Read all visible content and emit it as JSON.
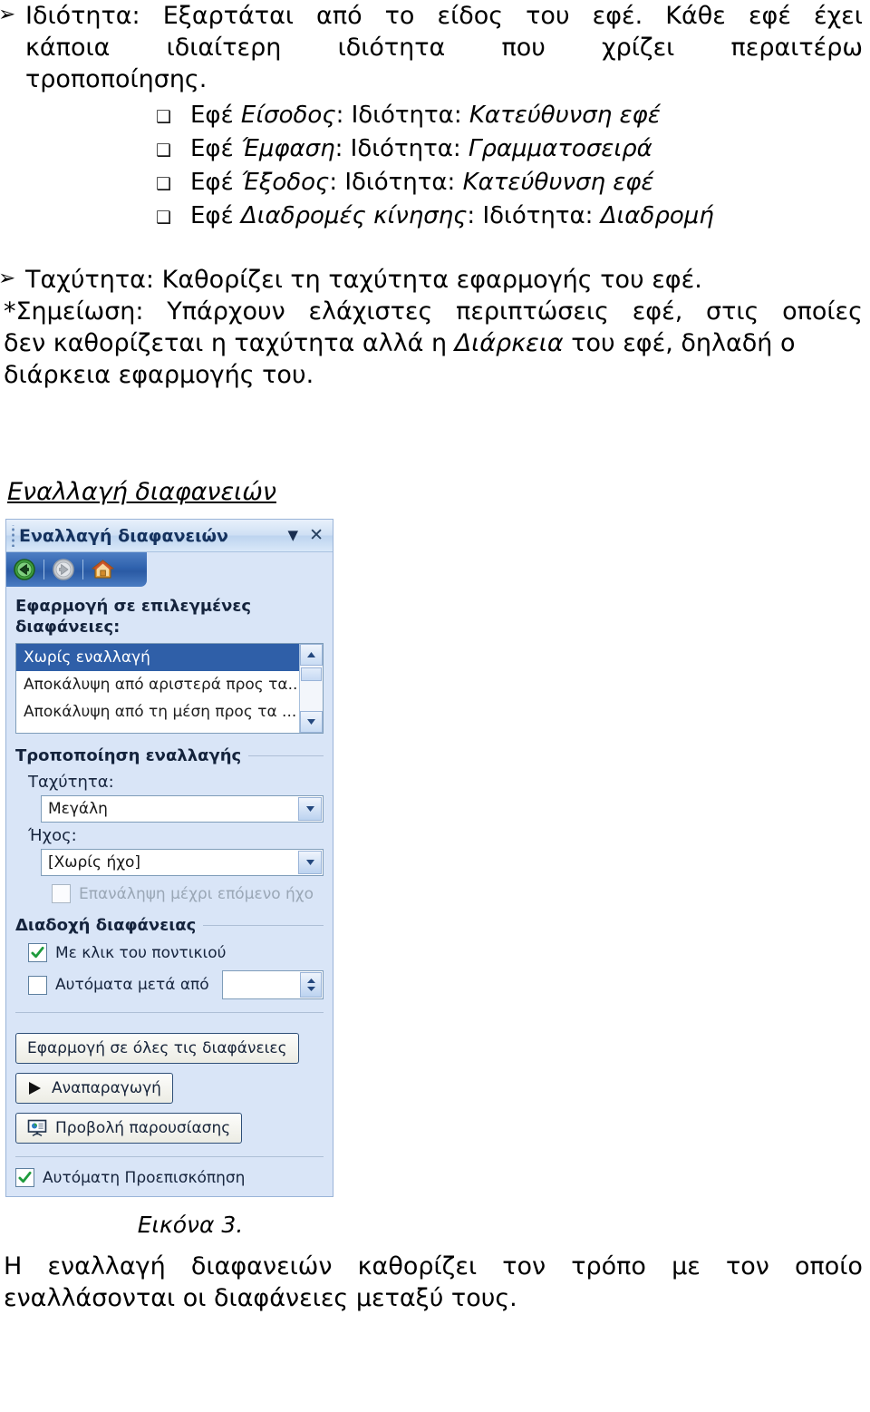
{
  "document": {
    "bullet_arrow": "➢",
    "bullet_square": "❑",
    "property_para": {
      "line1_left": "Ιδιότητα:",
      "line1_w1": "Εξαρτάται",
      "line1_w2": "από",
      "line1_w3": "το",
      "line1_w4": "είδος",
      "line1_w5": "του",
      "line1_w6": "εφέ.",
      "line1_w7": "Κάθε",
      "line1_w8": "εφέ",
      "line1_w9": "έχει",
      "line2_w1": "κάποια",
      "line2_w2": "ιδιαίτερη",
      "line2_w3": "ιδιότητα",
      "line2_w4": "που",
      "line2_w5": "χρίζει",
      "line2_w6": "περαιτέρω",
      "line3": "τροποποίησης."
    },
    "effect_list": [
      {
        "prefix": "Εφέ ",
        "name": "Είσοδος",
        "mid": ": Ιδιότητα: ",
        "value": "Κατεύθυνση εφέ"
      },
      {
        "prefix": "Εφέ ",
        "name": "Έμφαση",
        "mid": ": Ιδιότητα: ",
        "value": "Γραμματοσειρά"
      },
      {
        "prefix": "Εφέ ",
        "name": "Έξοδος",
        "mid": ": Ιδιότητα: ",
        "value": "Κατεύθυνση εφέ"
      },
      {
        "prefix": "Εφέ ",
        "name": "Διαδρομές κίνησης",
        "mid": ": Ιδιότητα: ",
        "value": "Διαδρομή"
      }
    ],
    "speed_para": {
      "line1": "Ταχύτητα: Καθορίζει τη ταχύτητα εφαρμογής του εφέ.",
      "note_w1": "*Σημείωση:",
      "note_w2": "Υπάρχουν",
      "note_w3": "ελάχιστες",
      "note_w4": "περιπτώσεις",
      "note_w5": "εφέ,",
      "note_w6": "στις",
      "note_w7": "οποίες",
      "line3_a": "δεν καθορίζεται η ταχύτητα αλλά η ",
      "line3_it": "Διάρκεια",
      "line3_b": " του εφέ, δηλαδή ο",
      "line4": "διάρκεια εφαρμογής του."
    },
    "section_heading": "Εναλλαγή διαφανειών",
    "figure_caption": "Εικόνα 3.",
    "closing_para": {
      "l1_w1": "Η",
      "l1_w2": "εναλλαγή",
      "l1_w3": "διαφανειών",
      "l1_w4": "καθορίζει",
      "l1_w5": "τον",
      "l1_w6": "τρόπο",
      "l1_w7": "με",
      "l1_w8": "τον",
      "l1_w9": "οποίο",
      "l2": "εναλλάσονται οι διαφάνειες μεταξύ τους."
    }
  },
  "task_pane": {
    "title": "Εναλλαγή διαφανειών",
    "titlebar_dropdown_glyph": "▼",
    "titlebar_close_glyph": "✕",
    "toolbar": {
      "back_label": "Πίσω",
      "forward_label": "Εμπρός",
      "home_label": "Αρχική"
    },
    "apply_to_selected_label_line1": "Εφαρμογή σε επιλεγμένες",
    "apply_to_selected_label_line2": "διαφάνειες:",
    "transition_list": [
      "Χωρίς εναλλαγή",
      "Αποκάλυψη από αριστερά προς τα...",
      "Αποκάλυψη από τη μέση προς τα ..."
    ],
    "transition_selected_index": 0,
    "scroll_up_glyph": "⌃",
    "scroll_down_glyph": "⌄",
    "modify_group_label": "Τροποποίηση εναλλαγής",
    "speed_label": "Ταχύτητα:",
    "speed_value": "Μεγάλη",
    "sound_label": "Ήχος:",
    "sound_value": "[Χωρίς ήχο]",
    "loop_sound_label": "Επανάληψη μέχρι επόμενο ήχο",
    "loop_sound_checked": false,
    "loop_sound_disabled": true,
    "advance_group_label": "Διαδοχή διαφάνειας",
    "on_click_label": "Με κλικ του ποντικιού",
    "on_click_checked": true,
    "auto_after_label": "Αυτόματα μετά από",
    "auto_after_checked": false,
    "auto_after_value": "",
    "spin_up_glyph": "▲",
    "spin_down_glyph": "▼",
    "apply_all_label": "Εφαρμογή σε όλες τις διαφάνειες",
    "play_label": "Αναπαραγωγή",
    "slideshow_label": "Προβολή παρουσίασης",
    "autopreview_label": "Αυτόματη Προεπισκόπηση",
    "autopreview_checked": true,
    "colors": {
      "pane_background": "#d9e5f7",
      "selection_blue": "#2f5fa8",
      "toolbar_blue": "#2f62ad",
      "title_text": "#15325e",
      "check_green": "#1e9b3c"
    }
  }
}
